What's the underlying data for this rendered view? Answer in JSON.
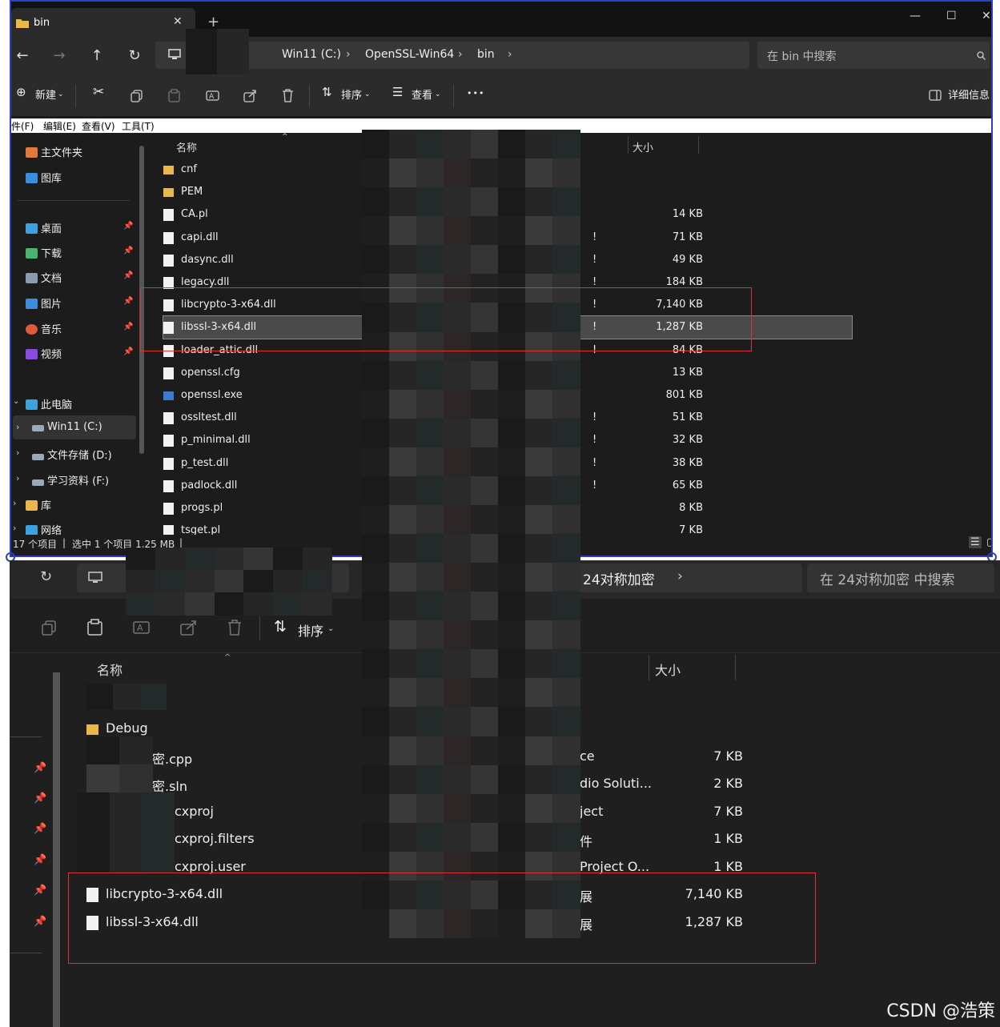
{
  "top_window": {
    "tab_title": "bin",
    "address": {
      "crumbs": [
        "Win11 (C:)",
        "OpenSSL-Win64",
        "bin"
      ]
    },
    "search_placeholder": "在 bin 中搜索",
    "toolbar": {
      "new": "新建",
      "sort": "排序",
      "view": "查看",
      "more": "•••",
      "details": "详细信息"
    },
    "menubar": [
      "件(F)",
      "编辑(E)",
      "查看(V)",
      "工具(T)"
    ],
    "sidebar": {
      "quick": [
        {
          "label": "主文件夹",
          "icon": "home-icon",
          "color": "#e07a3a"
        },
        {
          "label": "图库",
          "icon": "gallery-icon",
          "color": "#3a8ee0"
        }
      ],
      "pinned": [
        {
          "label": "桌面",
          "icon": "desktop-icon",
          "color": "#3aa3e0"
        },
        {
          "label": "下载",
          "icon": "download-icon",
          "color": "#4bb46e"
        },
        {
          "label": "文档",
          "icon": "document-icon",
          "color": "#8a9bb0"
        },
        {
          "label": "图片",
          "icon": "pictures-icon",
          "color": "#3a8ee0"
        },
        {
          "label": "音乐",
          "icon": "music-icon",
          "color": "#e05a3a"
        },
        {
          "label": "视频",
          "icon": "video-icon",
          "color": "#8a4ae0"
        }
      ],
      "drives": [
        {
          "label": "此电脑",
          "icon": "pc-icon",
          "color": "#3aa3e0"
        },
        {
          "label": "Win11 (C:)",
          "icon": "drive-icon",
          "color": "#9ab"
        },
        {
          "label": "文件存储 (D:)",
          "icon": "drive-icon",
          "color": "#9ab"
        },
        {
          "label": "学习资料 (F:)",
          "icon": "drive-icon",
          "color": "#9ab"
        },
        {
          "label": "库",
          "icon": "library-icon",
          "color": "#e8b84a"
        },
        {
          "label": "网络",
          "icon": "network-icon",
          "color": "#3aa3e0"
        }
      ]
    },
    "columns": {
      "name": "名称",
      "size": "大小"
    },
    "files": [
      {
        "name": "cnf",
        "size": "",
        "type": "folder",
        "typechar": ""
      },
      {
        "name": "PEM",
        "size": "",
        "type": "folder",
        "typechar": ""
      },
      {
        "name": "CA.pl",
        "size": "14 KB",
        "type": "file",
        "typechar": ""
      },
      {
        "name": "capi.dll",
        "size": "71 KB",
        "type": "dll",
        "typechar": "!"
      },
      {
        "name": "dasync.dll",
        "size": "49 KB",
        "type": "dll",
        "typechar": "!"
      },
      {
        "name": "legacy.dll",
        "size": "184 KB",
        "type": "dll",
        "typechar": "!"
      },
      {
        "name": "libcrypto-3-x64.dll",
        "size": "7,140 KB",
        "type": "dll",
        "typechar": "!"
      },
      {
        "name": "libssl-3-x64.dll",
        "size": "1,287 KB",
        "type": "dll",
        "typechar": "!"
      },
      {
        "name": "loader_attic.dll",
        "size": "84 KB",
        "type": "dll",
        "typechar": "!"
      },
      {
        "name": "openssl.cfg",
        "size": "13 KB",
        "type": "file",
        "typechar": ""
      },
      {
        "name": "openssl.exe",
        "size": "801 KB",
        "type": "exe",
        "typechar": ""
      },
      {
        "name": "ossltest.dll",
        "size": "51 KB",
        "type": "dll",
        "typechar": "!"
      },
      {
        "name": "p_minimal.dll",
        "size": "32 KB",
        "type": "dll",
        "typechar": "!"
      },
      {
        "name": "p_test.dll",
        "size": "38 KB",
        "type": "dll",
        "typechar": "!"
      },
      {
        "name": "padlock.dll",
        "size": "65 KB",
        "type": "dll",
        "typechar": "!"
      },
      {
        "name": "progs.pl",
        "size": "8 KB",
        "type": "file",
        "typechar": ""
      },
      {
        "name": "tsget.pl",
        "size": "7 KB",
        "type": "file",
        "typechar": ""
      }
    ],
    "status": {
      "count": "17 个项目",
      "selected": "选中 1 个项目 1.25 MB"
    }
  },
  "bottom_window": {
    "address_tail": "24对称加密",
    "search_placeholder": "在 24对称加密 中搜索",
    "toolbar": {
      "sort": "排序"
    },
    "columns": {
      "name": "名称",
      "size": "大小"
    },
    "files": [
      {
        "name": "Debug",
        "type_text": "",
        "size": "",
        "kind": "folder"
      },
      {
        "name": "密.cpp",
        "type_text": "ce",
        "size": "7 KB",
        "kind": "file"
      },
      {
        "name": "密.sln",
        "type_text": "dio Soluti...",
        "size": "2 KB",
        "kind": "file"
      },
      {
        "name": "cxproj",
        "type_text": "ject",
        "size": "7 KB",
        "kind": "file"
      },
      {
        "name": "cxproj.filters",
        "type_text": "件",
        "size": "1 KB",
        "kind": "file"
      },
      {
        "name": "cxproj.user",
        "type_text": "Project O...",
        "size": "1 KB",
        "kind": "file"
      },
      {
        "name": "libcrypto-3-x64.dll",
        "type_text": "展",
        "size": "7,140 KB",
        "kind": "dll"
      },
      {
        "name": "libssl-3-x64.dll",
        "type_text": "展",
        "size": "1,287 KB",
        "kind": "dll"
      }
    ]
  },
  "watermark": "CSDN @浩策",
  "colors": {
    "highlight_box": "#dd3333",
    "window_border": "#2d3fbf",
    "folder": "#e8b84a"
  }
}
